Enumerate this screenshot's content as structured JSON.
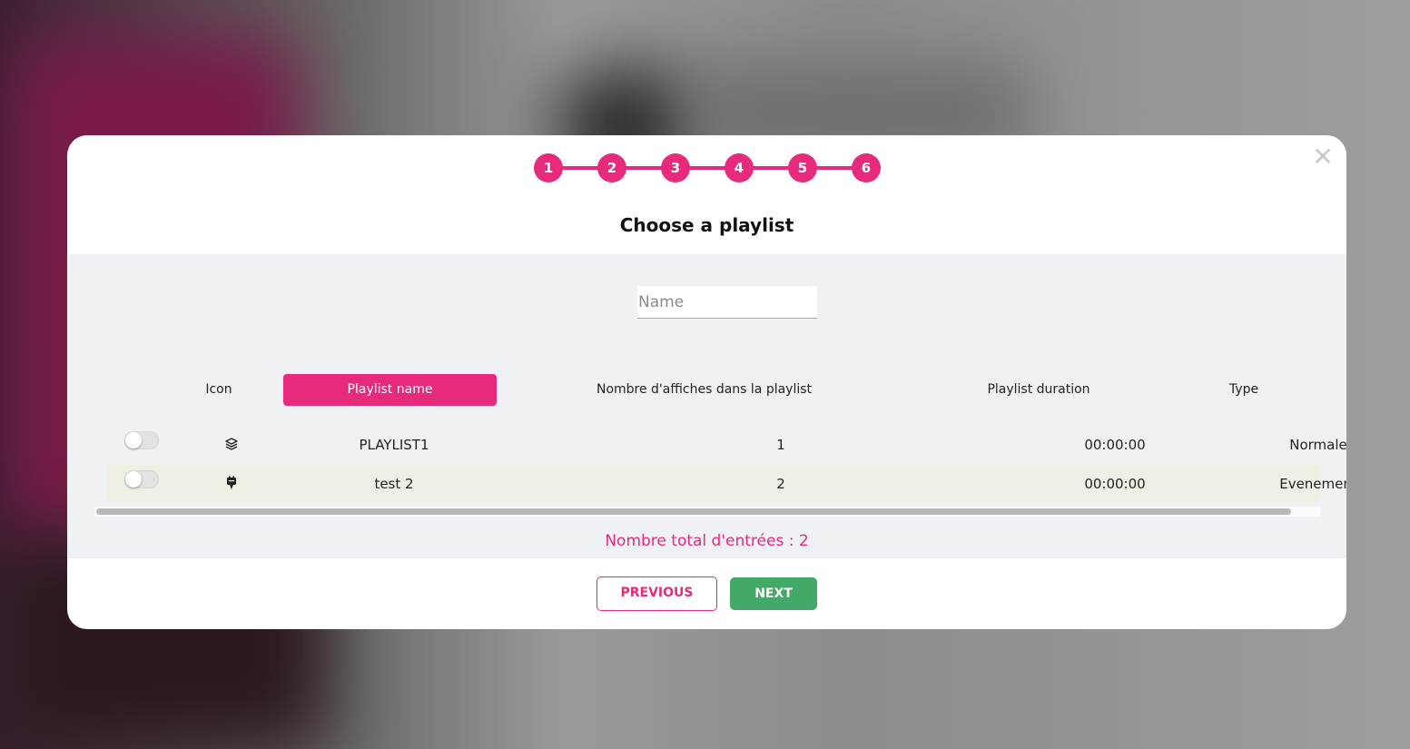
{
  "colors": {
    "accent": "#e72a7c",
    "next_button": "#42a968",
    "alt_row": "#efefe3",
    "content_bg": "#f0f1f5"
  },
  "close_icon": "close-icon",
  "steps": [
    "1",
    "2",
    "3",
    "4",
    "5",
    "6"
  ],
  "title": "Choose a playlist",
  "search": {
    "placeholder": "Name",
    "value": ""
  },
  "table": {
    "columns": {
      "icon": "Icon",
      "playlist_name": "Playlist name",
      "count": "Nombre d'affiches dans la playlist",
      "duration": "Playlist duration",
      "type": "Type"
    },
    "rows": [
      {
        "icon": "layers-icon",
        "name": "PLAYLIST1",
        "count": "1",
        "duration": "00:00:00",
        "type": "Normale",
        "selected": false
      },
      {
        "icon": "event-icon",
        "name": "test 2",
        "count": "2",
        "duration": "00:00:00",
        "type": "Evenement",
        "selected": false
      }
    ]
  },
  "total": "Nombre total d'entrées : 2",
  "buttons": {
    "previous": "PREVIOUS",
    "next": "NEXT"
  }
}
